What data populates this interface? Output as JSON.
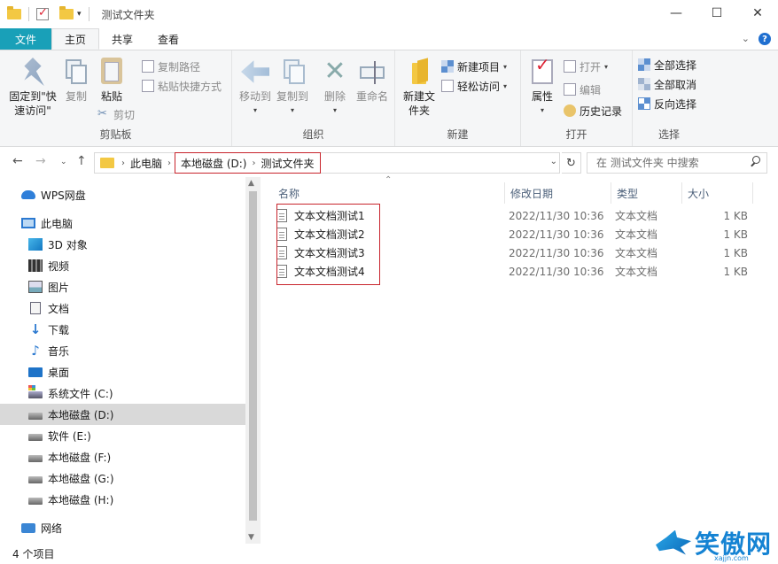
{
  "window": {
    "title": "测试文件夹",
    "controls": {
      "minimize": "—",
      "maximize": "☐",
      "close": "✕"
    }
  },
  "tabs": {
    "file": "文件",
    "home": "主页",
    "share": "共享",
    "view": "查看"
  },
  "ribbon": {
    "clipboard": {
      "label": "剪贴板",
      "pin": "固定到\"快速访问\"",
      "copy": "复制",
      "paste": "粘贴",
      "copy_path": "复制路径",
      "paste_shortcut": "粘贴快捷方式",
      "cut": "剪切"
    },
    "organize": {
      "label": "组织",
      "move_to": "移动到",
      "copy_to": "复制到",
      "delete": "删除",
      "rename": "重命名"
    },
    "new": {
      "label": "新建",
      "new_folder": "新建文件夹",
      "new_item": "新建项目",
      "easy_access": "轻松访问"
    },
    "open": {
      "label": "打开",
      "properties": "属性",
      "open": "打开",
      "edit": "编辑",
      "history": "历史记录"
    },
    "select": {
      "label": "选择",
      "select_all": "全部选择",
      "select_none": "全部取消",
      "invert": "反向选择"
    }
  },
  "address": {
    "crumbs": [
      "此电脑",
      "本地磁盘 (D:)",
      "测试文件夹"
    ],
    "search_placeholder": "在 测试文件夹 中搜索"
  },
  "nav": {
    "items": [
      {
        "label": "WPS网盘",
        "icon": "cloud-icon"
      },
      {
        "label": "此电脑",
        "icon": "computer-icon"
      },
      {
        "label": "3D 对象",
        "icon": "cube-icon"
      },
      {
        "label": "视频",
        "icon": "video-icon"
      },
      {
        "label": "图片",
        "icon": "picture-icon"
      },
      {
        "label": "文档",
        "icon": "document-icon"
      },
      {
        "label": "下载",
        "icon": "download-icon"
      },
      {
        "label": "音乐",
        "icon": "music-icon"
      },
      {
        "label": "桌面",
        "icon": "desktop-icon"
      },
      {
        "label": "系统文件 (C:)",
        "icon": "system-drive-icon"
      },
      {
        "label": "本地磁盘 (D:)",
        "icon": "drive-icon"
      },
      {
        "label": "软件 (E:)",
        "icon": "drive-icon"
      },
      {
        "label": "本地磁盘 (F:)",
        "icon": "drive-icon"
      },
      {
        "label": "本地磁盘 (G:)",
        "icon": "drive-icon"
      },
      {
        "label": "本地磁盘 (H:)",
        "icon": "drive-icon"
      },
      {
        "label": "网络",
        "icon": "network-icon"
      }
    ]
  },
  "columns": {
    "name": "名称",
    "modified": "修改日期",
    "type": "类型",
    "size": "大小"
  },
  "files": [
    {
      "name": "文本文档测试1",
      "modified": "2022/11/30 10:36",
      "type": "文本文档",
      "size": "1 KB"
    },
    {
      "name": "文本文档测试2",
      "modified": "2022/11/30 10:36",
      "type": "文本文档",
      "size": "1 KB"
    },
    {
      "name": "文本文档测试3",
      "modified": "2022/11/30 10:36",
      "type": "文本文档",
      "size": "1 KB"
    },
    {
      "name": "文本文档测试4",
      "modified": "2022/11/30 10:36",
      "type": "文本文档",
      "size": "1 KB"
    }
  ],
  "status": {
    "count": "4 个项目"
  },
  "watermark": {
    "text": "笑傲网",
    "url": "xajjn.com"
  },
  "colors": {
    "file_tab": "#19a0b8",
    "highlight_box": "#c8242c",
    "selected_nav": "#d9d9d9"
  }
}
